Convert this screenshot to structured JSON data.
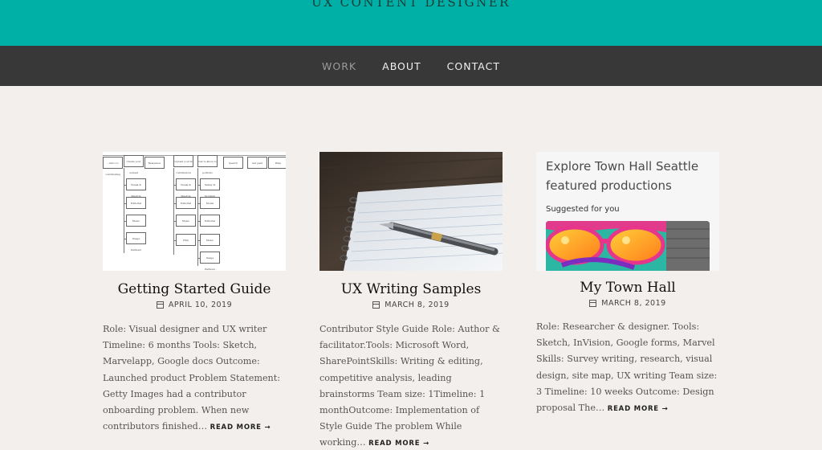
{
  "site": {
    "title": "UX CONTENT DESIGNER"
  },
  "nav": {
    "items": [
      "WORK",
      "ABOUT",
      "CONTACT"
    ],
    "active": "WORK"
  },
  "posts": [
    {
      "title": "Getting Started Guide",
      "date": "APRIL 10, 2019",
      "excerpt": "Role: Visual designer and UX writer Timeline: 6 months Tools: Sketch, Marvelapp, Google docs Outcome: Launched product Problem Statement: Getty Images had a contributor onboarding problem. When new contributors finished…",
      "read_more": "READ MORE →",
      "thumb_labels": [
        "...intro to contributing",
        "Create your content",
        "Relevance",
        "Upload your & contributors",
        "Get to know to portfolio",
        "Search",
        "Get paid",
        "Help",
        "Visual & lifestyle imagery",
        "Editorial",
        "Music",
        "Image Partners",
        "Visual & lifestyle imagery",
        "Editorial",
        "Music",
        "Film",
        "Safety & Incident",
        "Model",
        "Editorial",
        "Music",
        "Image Partners"
      ]
    },
    {
      "title": "UX Writing Samples",
      "date": "MARCH 8, 2019",
      "excerpt": "Contributor Style Guide Role: Author & facilitator.Tools: Microsoft Word, SharePointSkills: Writing & editing, competitive analysis, leading brainstorms Team size: 1Timeline: 1 monthOutcome: Implementation of Style Guide The problem While working…",
      "read_more": "READ MORE →"
    },
    {
      "title": "My Town Hall",
      "date": "MARCH 8, 2019",
      "excerpt": "Role: Researcher & designer. Tools: Sketch, InVision, Google forms, Marvel Skills: Survey writing, research, visual design, site map, UX writing Team size: 3 Timeline: 10 weeks Outcome: Design proposal The…",
      "read_more": "READ MORE →",
      "thumb_heading": "Explore Town Hall Seattle featured productions",
      "thumb_subheading": "Suggested for you"
    }
  ],
  "colors": {
    "header": "#00b0a6",
    "nav": "#383838",
    "background": "#f3efec"
  }
}
